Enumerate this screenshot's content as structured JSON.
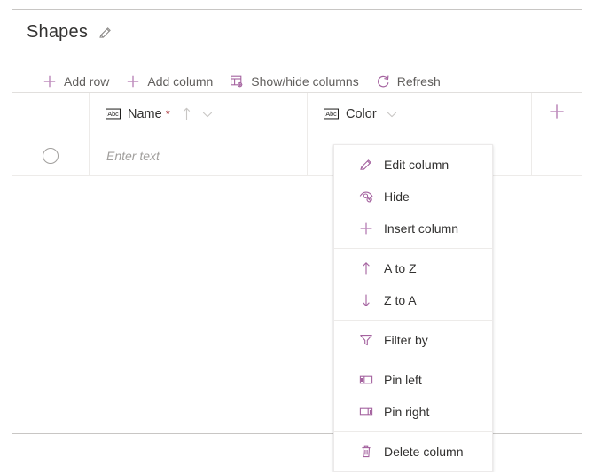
{
  "theme": {
    "accent": "#a4629f",
    "accent_light": "#bf8ebd",
    "text": "#323130",
    "muted_text": "#605e5c",
    "placeholder_text": "#a19f9d",
    "required_red": "#a4262c",
    "border": "#c8c6c4",
    "grid_line": "#edebe9"
  },
  "header": {
    "title": "Shapes",
    "edit_title_icon": "pencil-icon"
  },
  "toolbar": {
    "items": [
      {
        "label": "Add row",
        "icon": "plus-icon"
      },
      {
        "label": "Add column",
        "icon": "plus-icon"
      },
      {
        "label": "Show/hide columns",
        "icon": "table-settings-icon"
      },
      {
        "label": "Refresh",
        "icon": "refresh-icon"
      }
    ]
  },
  "grid": {
    "add_column_icon": "plus-icon",
    "columns": [
      {
        "name": "Name",
        "type_icon": "abc-text-type-icon",
        "required": true,
        "required_marker": "*",
        "sort_icon": "sort-ascending-arrow-icon",
        "menu_icon": "chevron-down-icon"
      },
      {
        "name": "Color",
        "type_icon": "abc-text-type-icon",
        "required": false,
        "required_marker": "",
        "sort_icon": "",
        "menu_icon": "chevron-down-icon"
      }
    ],
    "rows": [
      {
        "selector_icon": "radio-circle-icon",
        "name_value": "",
        "name_placeholder": "Enter text",
        "color_value": ""
      }
    ]
  },
  "column_menu": {
    "for_column": "Color",
    "groups": [
      {
        "items": [
          {
            "label": "Edit column",
            "icon": "pencil-icon"
          },
          {
            "label": "Hide",
            "icon": "eye-hide-icon"
          },
          {
            "label": "Insert column",
            "icon": "plus-icon"
          }
        ]
      },
      {
        "items": [
          {
            "label": "A to Z",
            "icon": "arrow-up-icon"
          },
          {
            "label": "Z to A",
            "icon": "arrow-down-icon"
          }
        ]
      },
      {
        "items": [
          {
            "label": "Filter by",
            "icon": "funnel-filter-icon"
          }
        ]
      },
      {
        "items": [
          {
            "label": "Pin left",
            "icon": "pin-left-icon"
          },
          {
            "label": "Pin right",
            "icon": "pin-right-icon"
          }
        ]
      },
      {
        "items": [
          {
            "label": "Delete column",
            "icon": "trash-delete-icon"
          }
        ]
      }
    ]
  }
}
